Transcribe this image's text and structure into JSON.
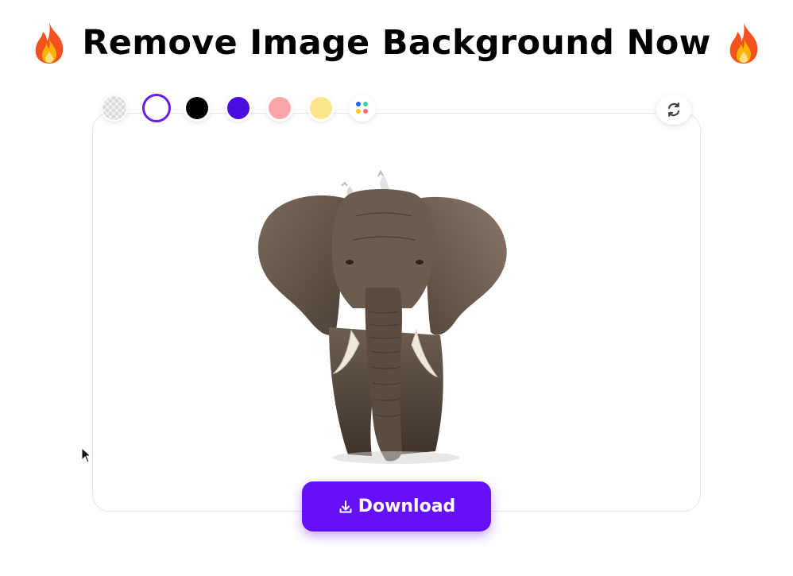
{
  "header": {
    "title": "Remove Image Background Now",
    "left_icon": "fire-icon",
    "right_icon": "fire-icon"
  },
  "background_picker": {
    "swatches": [
      {
        "name": "transparent",
        "color": "transparent"
      },
      {
        "name": "white",
        "color": "#ffffff",
        "selected": true
      },
      {
        "name": "black",
        "color": "#000000"
      },
      {
        "name": "purple",
        "color": "#4a0fe0"
      },
      {
        "name": "pink",
        "color": "#f9a6a6"
      },
      {
        "name": "yellow",
        "color": "#fde68a"
      },
      {
        "name": "more-colors",
        "icon": "color-palette-icon"
      }
    ],
    "selection_color": "#6a1bf0"
  },
  "toolbar": {
    "reset_icon": "refresh-icon"
  },
  "preview": {
    "subject": "elephant-image"
  },
  "actions": {
    "download_label": "Download",
    "download_icon": "download-icon",
    "download_color": "#6610f9"
  }
}
